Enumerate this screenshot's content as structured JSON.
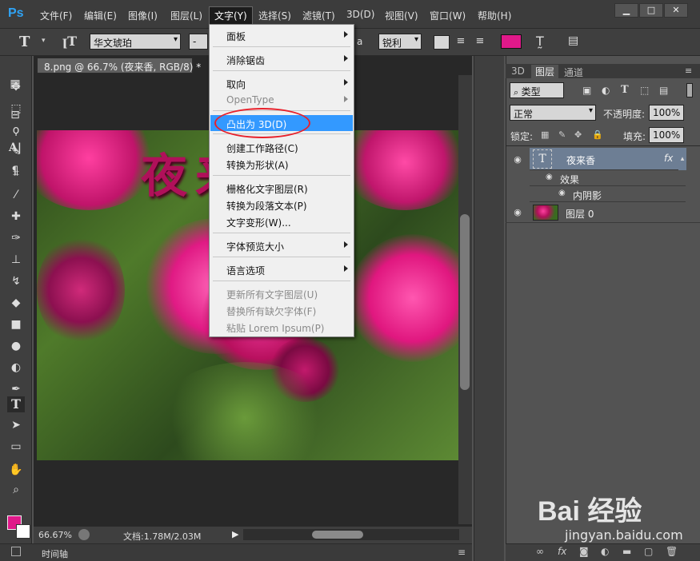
{
  "app": {
    "logo": "Ps"
  },
  "menubar": {
    "items": [
      "文件(F)",
      "编辑(E)",
      "图像(I)",
      "图层(L)",
      "文字(Y)",
      "选择(S)",
      "滤镜(T)",
      "3D(D)",
      "视图(V)",
      "窗口(W)",
      "帮助(H)"
    ],
    "active": "文字(Y)"
  },
  "window_controls": {
    "minimize": "▁",
    "maximize": "□",
    "close": "✕"
  },
  "options": {
    "font_family": "华文琥珀",
    "font_style": "-",
    "aa_label": "a",
    "antialias": "锐利",
    "color": "#e0198a"
  },
  "document": {
    "tab_title": "8.png @ 66.7% (夜来香, RGB/8) *",
    "headline": "夜来香",
    "zoom": "66.67%",
    "doc_info": "文档:1.78M/2.03M"
  },
  "timeline": {
    "label": "时间轴"
  },
  "dropdown": {
    "items": [
      {
        "label": "面板",
        "submenu": true,
        "disabled": false
      },
      {
        "label": "消除锯齿",
        "submenu": true,
        "disabled": false
      },
      {
        "label": "取向",
        "submenu": true,
        "disabled": false
      },
      {
        "label": "OpenType",
        "submenu": true,
        "disabled": true
      },
      {
        "label": "凸出为 3D(D)",
        "submenu": false,
        "disabled": false,
        "highlight": true
      },
      {
        "label": "创建工作路径(C)",
        "submenu": false,
        "disabled": false
      },
      {
        "label": "转换为形状(A)",
        "submenu": false,
        "disabled": false
      },
      {
        "label": "栅格化文字图层(R)",
        "submenu": false,
        "disabled": false
      },
      {
        "label": "转换为段落文本(P)",
        "submenu": false,
        "disabled": false
      },
      {
        "label": "文字变形(W)...",
        "submenu": false,
        "disabled": false
      },
      {
        "label": "字体预览大小",
        "submenu": true,
        "disabled": false
      },
      {
        "label": "语言选项",
        "submenu": true,
        "disabled": false
      },
      {
        "label": "更新所有文字图层(U)",
        "submenu": false,
        "disabled": true
      },
      {
        "label": "替换所有缺欠字体(F)",
        "submenu": false,
        "disabled": true
      },
      {
        "label": "粘贴 Lorem Ipsum(P)",
        "submenu": false,
        "disabled": true
      }
    ]
  },
  "layers_panel": {
    "tabs": [
      "3D",
      "图层",
      "通道"
    ],
    "active_tab": "图层",
    "filter_kind": "类型",
    "blend_mode": "正常",
    "opacity_label": "不透明度:",
    "opacity": "100%",
    "lock_label": "锁定:",
    "fill_label": "填充:",
    "fill": "100%",
    "layers": [
      {
        "name": "夜来香",
        "type": "text",
        "fx": "fx",
        "selected": true
      },
      {
        "name": "效果",
        "type": "effects-group"
      },
      {
        "name": "内阴影",
        "type": "effect"
      },
      {
        "name": "图层 0",
        "type": "image"
      }
    ]
  },
  "watermark": {
    "logo": "Bai 经验",
    "url": "jingyan.baidu.com"
  }
}
